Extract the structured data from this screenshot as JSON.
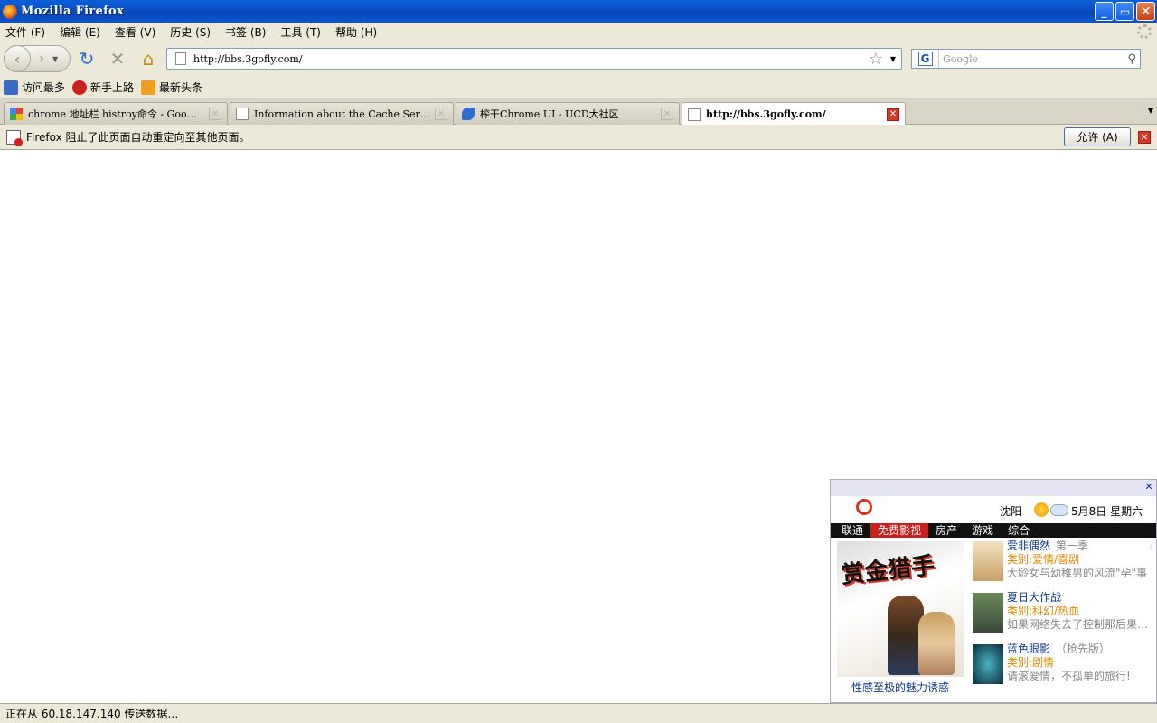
{
  "window": {
    "title": "Mozilla Firefox",
    "min": "_",
    "max": "▭",
    "close": "✕"
  },
  "menubar": {
    "items": [
      "文件 (F)",
      "编辑 (E)",
      "查看 (V)",
      "历史 (S)",
      "书签 (B)",
      "工具 (T)",
      "帮助 (H)"
    ]
  },
  "navbar": {
    "back": "‹",
    "forward": "›",
    "reload": "↻",
    "stop": "✕",
    "home": "⌂",
    "url": "http://bbs.3gofly.com/",
    "star": "☆",
    "search_engine": "G",
    "search_placeholder": "Google",
    "search_icon": "⚲"
  },
  "bookmarks": [
    "访问最多",
    "新手上路",
    "最新头条"
  ],
  "tabs": [
    {
      "label": "chrome 地址栏 histroy命令 - Goo…",
      "icon": "google-icon"
    },
    {
      "label": "Information about the Cache Ser…",
      "icon": "page-icon"
    },
    {
      "label": "榨干Chrome UI - UCD大社区",
      "icon": "chrome-icon"
    },
    {
      "label": "http://bbs.3gofly.com/",
      "icon": "page-icon",
      "active": true
    }
  ],
  "notification": {
    "message": "Firefox 阻止了此页面自动重定向至其他页面。",
    "allow_button": "允许 (A)",
    "close": "✕"
  },
  "popup": {
    "close": "✕",
    "logo_text": "China unicom中国联通",
    "city": "沈阳",
    "date": "5月8日 星期六",
    "nav": [
      "联通",
      "免费影视",
      "房产",
      "游戏",
      "综合"
    ],
    "active_nav": 1,
    "poster_title": "赏金猎手",
    "poster_caption": "性感至极的魅力诱惑",
    "items": [
      {
        "name": "爱非偶然",
        "note": "第一季",
        "category": "类别:爱情/喜剧",
        "desc": "大龄女与幼稚男的风流\"孕\"事"
      },
      {
        "name": "夏日大作战",
        "note": "",
        "category": "类别:科幻/热血",
        "desc": "如果网络失去了控制那后果…"
      },
      {
        "name": "蓝色眼影",
        "note": "（抢先版）",
        "category": "类别:剧情",
        "desc": "请滚爱情，不孤单的旅行!"
      }
    ]
  },
  "statusbar": {
    "text": "正在从 60.18.147.140 传送数据…"
  }
}
